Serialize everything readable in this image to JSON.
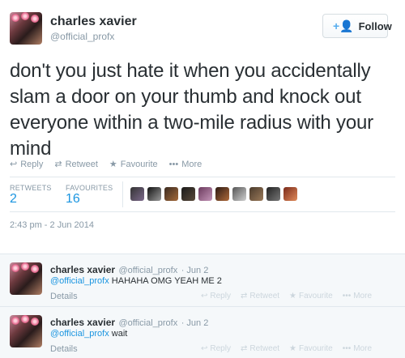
{
  "tweet": {
    "name": "charles xavier",
    "handle": "@official_profx",
    "follow_label": "Follow",
    "text": "don't you just hate it when you accidentally slam a door on your thumb and knock out everyone within a two-mile radius with your mind",
    "actions": {
      "reply": "Reply",
      "retweet": "Retweet",
      "favourite": "Favourite",
      "more": "More"
    },
    "stats": {
      "retweets_label": "RETWEETS",
      "retweets_value": "2",
      "favourites_label": "FAVOURITES",
      "favourites_value": "16"
    },
    "timestamp": "2:43 pm - 2 Jun 2014"
  },
  "replies": [
    {
      "name": "charles xavier",
      "handle": "@official_profx",
      "date": "· Jun 2",
      "mention": "@official_profx",
      "text": " HAHAHA OMG YEAH ME 2",
      "details": "Details",
      "actions": {
        "reply": "Reply",
        "retweet": "Retweet",
        "favourite": "Favourite",
        "more": "More"
      }
    },
    {
      "name": "charles xavier",
      "handle": "@official_profx",
      "date": "· Jun 2",
      "mention": "@official_profx",
      "text": " wait",
      "details": "Details",
      "actions": {
        "reply": "Reply",
        "retweet": "Retweet",
        "favourite": "Favourite",
        "more": "More"
      }
    }
  ],
  "colors": {
    "accent": "#1b95e0",
    "muted": "#8899a6",
    "reply_bg": "#f5f8fa"
  }
}
